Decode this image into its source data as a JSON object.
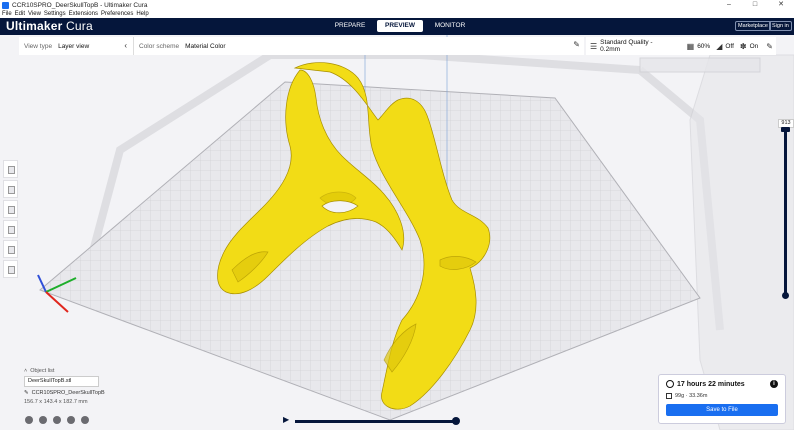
{
  "window": {
    "title": "CCR10SPRO_DeerSkullTopB - Ultimaker Cura",
    "controls": [
      "–",
      "□",
      "✕"
    ]
  },
  "menu": [
    "File",
    "Edit",
    "View",
    "Settings",
    "Extensions",
    "Preferences",
    "Help"
  ],
  "header": {
    "logo_bold": "Ultimaker",
    "logo_light": "Cura",
    "stages": [
      "PREPARE",
      "PREVIEW",
      "MONITOR"
    ],
    "active_stage": "PREVIEW",
    "marketplace": "Marketplace",
    "signin": "Sign in"
  },
  "view_panel": {
    "view_type_label": "View type",
    "view_type_value": "Layer view",
    "color_scheme_label": "Color scheme",
    "color_scheme_value": "Material Color"
  },
  "print_settings": {
    "profile": "Standard Quality - 0.2mm",
    "infill": "60%",
    "support": "Off",
    "adhesion": "On"
  },
  "layer_slider": {
    "max_layer": "913"
  },
  "object_list": {
    "header": "Object list",
    "file": "DeerSkullTopB.stl",
    "job_name": "CCR10SPRO_DeerSkullTopB",
    "dimensions": "156.7 x 143.4 x 182.7 mm"
  },
  "print_info": {
    "time": "17 hours 22 minutes",
    "material": "99g · 33.36m",
    "save_label": "Save to File"
  },
  "colors": {
    "header_bg": "#05163b",
    "accent": "#196ef0",
    "model": "#f2dc16",
    "model_shadow": "#b59f00"
  }
}
